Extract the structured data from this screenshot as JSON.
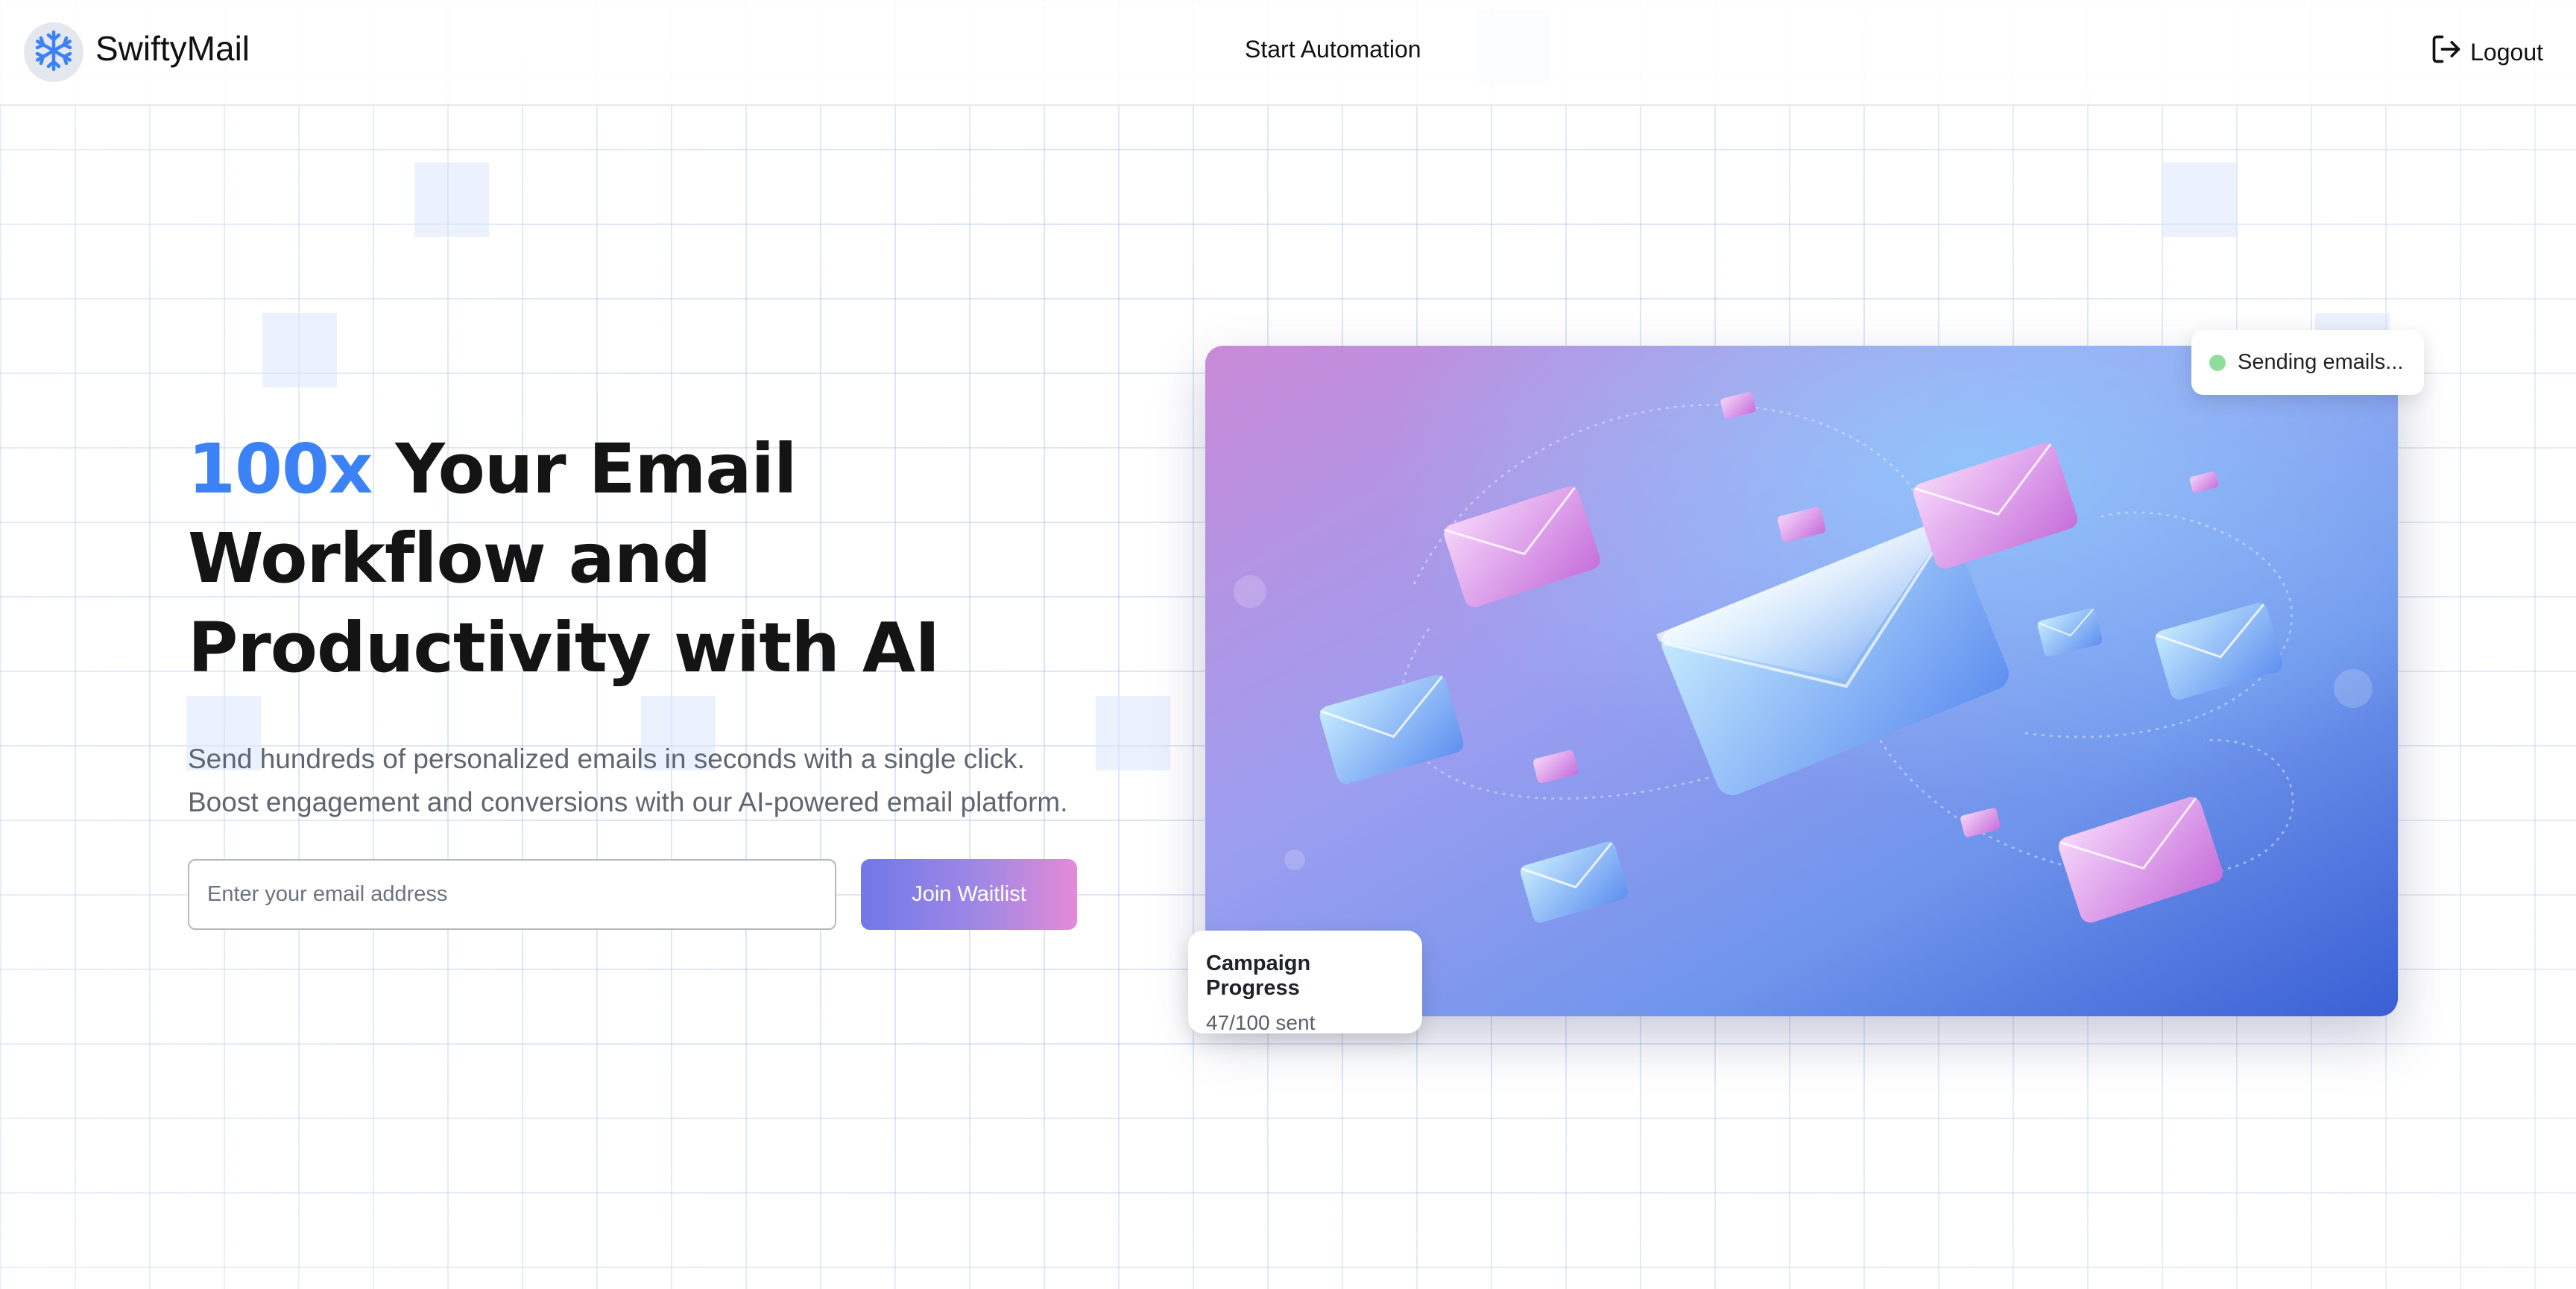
{
  "header": {
    "brand": "SwiftyMail",
    "logo_icon": "snowflake-icon",
    "nav_link": "Start Automation",
    "logout_label": "Logout",
    "logout_icon": "logout-icon"
  },
  "hero": {
    "headline_accent": "100x",
    "headline_rest": " Your Email Workflow and Productivity with AI",
    "subtext_line1": "Send hundreds of personalized emails in seconds with a single click.",
    "subtext_line2": "Boost engagement and conversions with our AI-powered email platform.",
    "email_placeholder": "Enter your email address",
    "email_value": "",
    "join_label": "Join Waitlist"
  },
  "status_badge": {
    "text": "Sending emails...",
    "dot_color": "#8fdc9b"
  },
  "progress_card": {
    "title": "Campaign Progress",
    "count": "47/100 sent",
    "sent": 47,
    "total": 100
  },
  "colors": {
    "accent": "#3b82f6",
    "button_gradient_start": "#7078e8",
    "button_gradient_end": "#e38ad8",
    "logo_snowflake": "#3b82f6"
  }
}
